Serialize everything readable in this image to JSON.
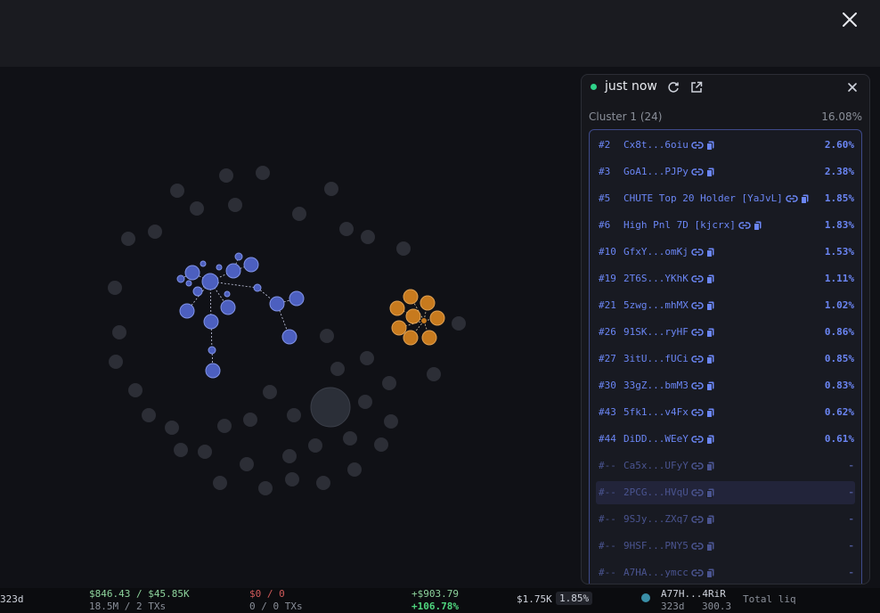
{
  "colors": {
    "active": "#6b86f5",
    "inactive": "#4a5490",
    "live": "#2fd38a",
    "cluster_blue": "#4c5fbf",
    "cluster_orange": "#c77a1e",
    "node_gray": "#2c2e36"
  },
  "topbar": {
    "close_icon": "close-icon"
  },
  "panel": {
    "status": "just now",
    "icons": [
      "refresh-icon",
      "external-link-icon",
      "close-icon"
    ],
    "cluster_name": "Cluster 1 (24)",
    "cluster_pct": "16.08%",
    "holders": [
      {
        "rank": "#2",
        "name": "Cx8t...6oiu",
        "pct": "2.60%",
        "active": true
      },
      {
        "rank": "#3",
        "name": "GoA1...PJPy",
        "pct": "2.38%",
        "active": true
      },
      {
        "rank": "#5",
        "name": "CHUTE Top 20 Holder [YaJvL]",
        "pct": "1.85%",
        "active": true
      },
      {
        "rank": "#6",
        "name": "High Pnl 7D [kjcrx]",
        "pct": "1.83%",
        "active": true
      },
      {
        "rank": "#10",
        "name": "GfxY...omKj",
        "pct": "1.53%",
        "active": true
      },
      {
        "rank": "#19",
        "name": "2T6S...YKhK",
        "pct": "1.11%",
        "active": true
      },
      {
        "rank": "#21",
        "name": "5zwg...mhMX",
        "pct": "1.02%",
        "active": true
      },
      {
        "rank": "#26",
        "name": "91SK...ryHF",
        "pct": "0.86%",
        "active": true
      },
      {
        "rank": "#27",
        "name": "3itU...fUCi",
        "pct": "0.85%",
        "active": true
      },
      {
        "rank": "#30",
        "name": "33gZ...bmM3",
        "pct": "0.83%",
        "active": true
      },
      {
        "rank": "#43",
        "name": "5fk1...v4Fx",
        "pct": "0.62%",
        "active": true
      },
      {
        "rank": "#44",
        "name": "DiDD...WEeY",
        "pct": "0.61%",
        "active": true
      },
      {
        "rank": "#--",
        "name": "Ca5x...UFyY",
        "pct": "-",
        "active": false
      },
      {
        "rank": "#--",
        "name": "2PCG...HVqU",
        "pct": "-",
        "active": false,
        "highlight": true
      },
      {
        "rank": "#--",
        "name": "9SJy...ZXq7",
        "pct": "-",
        "active": false
      },
      {
        "rank": "#--",
        "name": "9HSF...PNY5",
        "pct": "-",
        "active": false
      },
      {
        "rank": "#--",
        "name": "A7HA...ymcc",
        "pct": "-",
        "active": false
      }
    ]
  },
  "bottom": {
    "age": "323d",
    "vol": "$846.43 / $45.85K",
    "vol_sub": "18.5M / 2 TXs",
    "sell": "$0 / 0",
    "sell_sub": "0 / 0 TXs",
    "pnl": "+$903.79",
    "pnl_pct": "+106.78%",
    "hold": "$1.75K",
    "hold_pct": "1.85%",
    "addr": "A77H...4RiR",
    "addr_age": "323d",
    "addr_val": "300.3",
    "liq_label": "Total liq"
  }
}
